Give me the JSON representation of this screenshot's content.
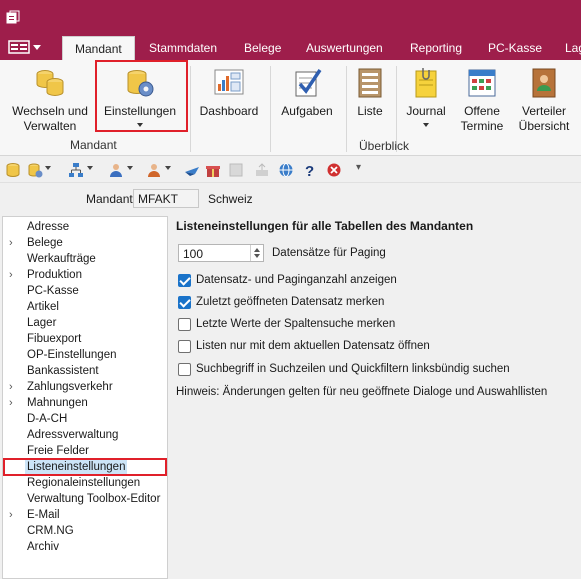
{
  "ribbon_tabs": [
    "Mandant",
    "Stammdaten",
    "Belege",
    "Auswertungen",
    "Reporting",
    "PC-Kasse",
    "Lag"
  ],
  "ribbon": {
    "wechseln_line1": "Wechseln und",
    "wechseln_line2": "Verwalten",
    "einstellungen": "Einstellungen",
    "dashboard": "Dashboard",
    "aufgaben": "Aufgaben",
    "liste": "Liste",
    "journal": "Journal",
    "offene_line1": "Offene",
    "offene_line2": "Termine",
    "verteiler_line1": "Verteiler",
    "verteiler_line2": "Übersicht",
    "group_mandant": "Mandant",
    "group_ueberblick": "Überblick"
  },
  "mandant": {
    "label": "Mandant",
    "value": "MFAKT",
    "country": "Schweiz"
  },
  "tree": [
    {
      "label": "Adresse",
      "expandable": false
    },
    {
      "label": "Belege",
      "expandable": true
    },
    {
      "label": "Werkaufträge",
      "expandable": false
    },
    {
      "label": "Produktion",
      "expandable": true
    },
    {
      "label": "PC-Kasse",
      "expandable": false
    },
    {
      "label": "Artikel",
      "expandable": false
    },
    {
      "label": "Lager",
      "expandable": false
    },
    {
      "label": "Fibuexport",
      "expandable": false
    },
    {
      "label": "OP-Einstellungen",
      "expandable": false
    },
    {
      "label": "Bankassistent",
      "expandable": false
    },
    {
      "label": "Zahlungsverkehr",
      "expandable": true
    },
    {
      "label": "Mahnungen",
      "expandable": true
    },
    {
      "label": "D-A-CH",
      "expandable": false
    },
    {
      "label": "Adressverwaltung",
      "expandable": false
    },
    {
      "label": "Freie Felder",
      "expandable": false
    },
    {
      "label": "Listeneinstellungen",
      "expandable": false,
      "selected": true
    },
    {
      "label": "Regionaleinstellungen",
      "expandable": false
    },
    {
      "label": "Verwaltung Toolbox-Editor",
      "expandable": false
    },
    {
      "label": "E-Mail",
      "expandable": true
    },
    {
      "label": "CRM.NG",
      "expandable": false
    },
    {
      "label": "Archiv",
      "expandable": false
    }
  ],
  "content": {
    "title": "Listeneinstellungen für alle Tabellen des Mandanten",
    "paging_value": "100",
    "paging_label": "Datensätze für Paging",
    "options": [
      {
        "label": "Datensatz- und Paginganzahl anzeigen",
        "checked": true
      },
      {
        "label": "Zuletzt geöffneten Datensatz merken",
        "checked": true
      },
      {
        "label": "Letzte Werte der Spaltensuche merken",
        "checked": false
      },
      {
        "label": "Listen nur mit dem aktuellen Datensatz öffnen",
        "checked": false
      },
      {
        "label": "Suchbegriff in Suchzeilen und Quickfiltern linksbündig suchen",
        "checked": false
      }
    ],
    "hint": "Hinweis: Änderungen gelten für neu geöffnete Dialoge und Auswahllisten"
  },
  "colors": {
    "title_bar": "#9e1e4b",
    "highlight": "#e0202a",
    "checkbox": "#1a73c9",
    "selection": "#cce4f7"
  }
}
